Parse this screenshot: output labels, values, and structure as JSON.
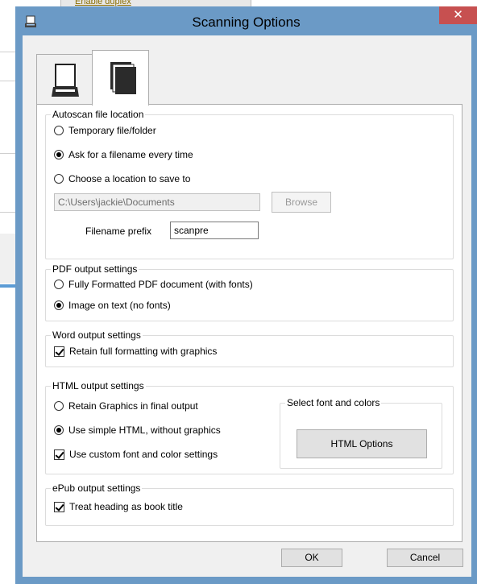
{
  "background": {
    "link_text": "Enable duplex"
  },
  "dialog": {
    "title": "Scanning Options",
    "close_glyph": "✕",
    "tabs": [
      {
        "name": "scanner",
        "icon": "scanner-icon"
      },
      {
        "name": "documents",
        "icon": "documents-icon"
      }
    ],
    "autoscan": {
      "legend": "Autoscan file location",
      "options": [
        "Temporary file/folder",
        "Ask for a filename every time",
        "Choose a location to save to"
      ],
      "selected": 1,
      "path_value": "C:\\Users\\jackie\\Documents",
      "browse_label": "Browse",
      "prefix_label": "Filename prefix",
      "prefix_value": "scanpre"
    },
    "pdf": {
      "legend": "PDF output settings",
      "options": [
        "Fully Formatted PDF document (with fonts)",
        "Image on text (no fonts)"
      ],
      "selected": 1
    },
    "word": {
      "legend": "Word output settings",
      "retain_label": "Retain full formatting with graphics",
      "retain_checked": true
    },
    "html": {
      "legend": "HTML output settings",
      "options": [
        "Retain Graphics in final output",
        "Use simple HTML, without graphics"
      ],
      "selected": 1,
      "custom_font_label": "Use custom font and color settings",
      "custom_font_checked": true,
      "font_group_legend": "Select font and colors",
      "html_options_label": "HTML Options"
    },
    "epub": {
      "legend": "ePub output settings",
      "heading_label": "Treat heading as book title",
      "heading_checked": true
    },
    "ok_label": "OK",
    "cancel_label": "Cancel"
  }
}
